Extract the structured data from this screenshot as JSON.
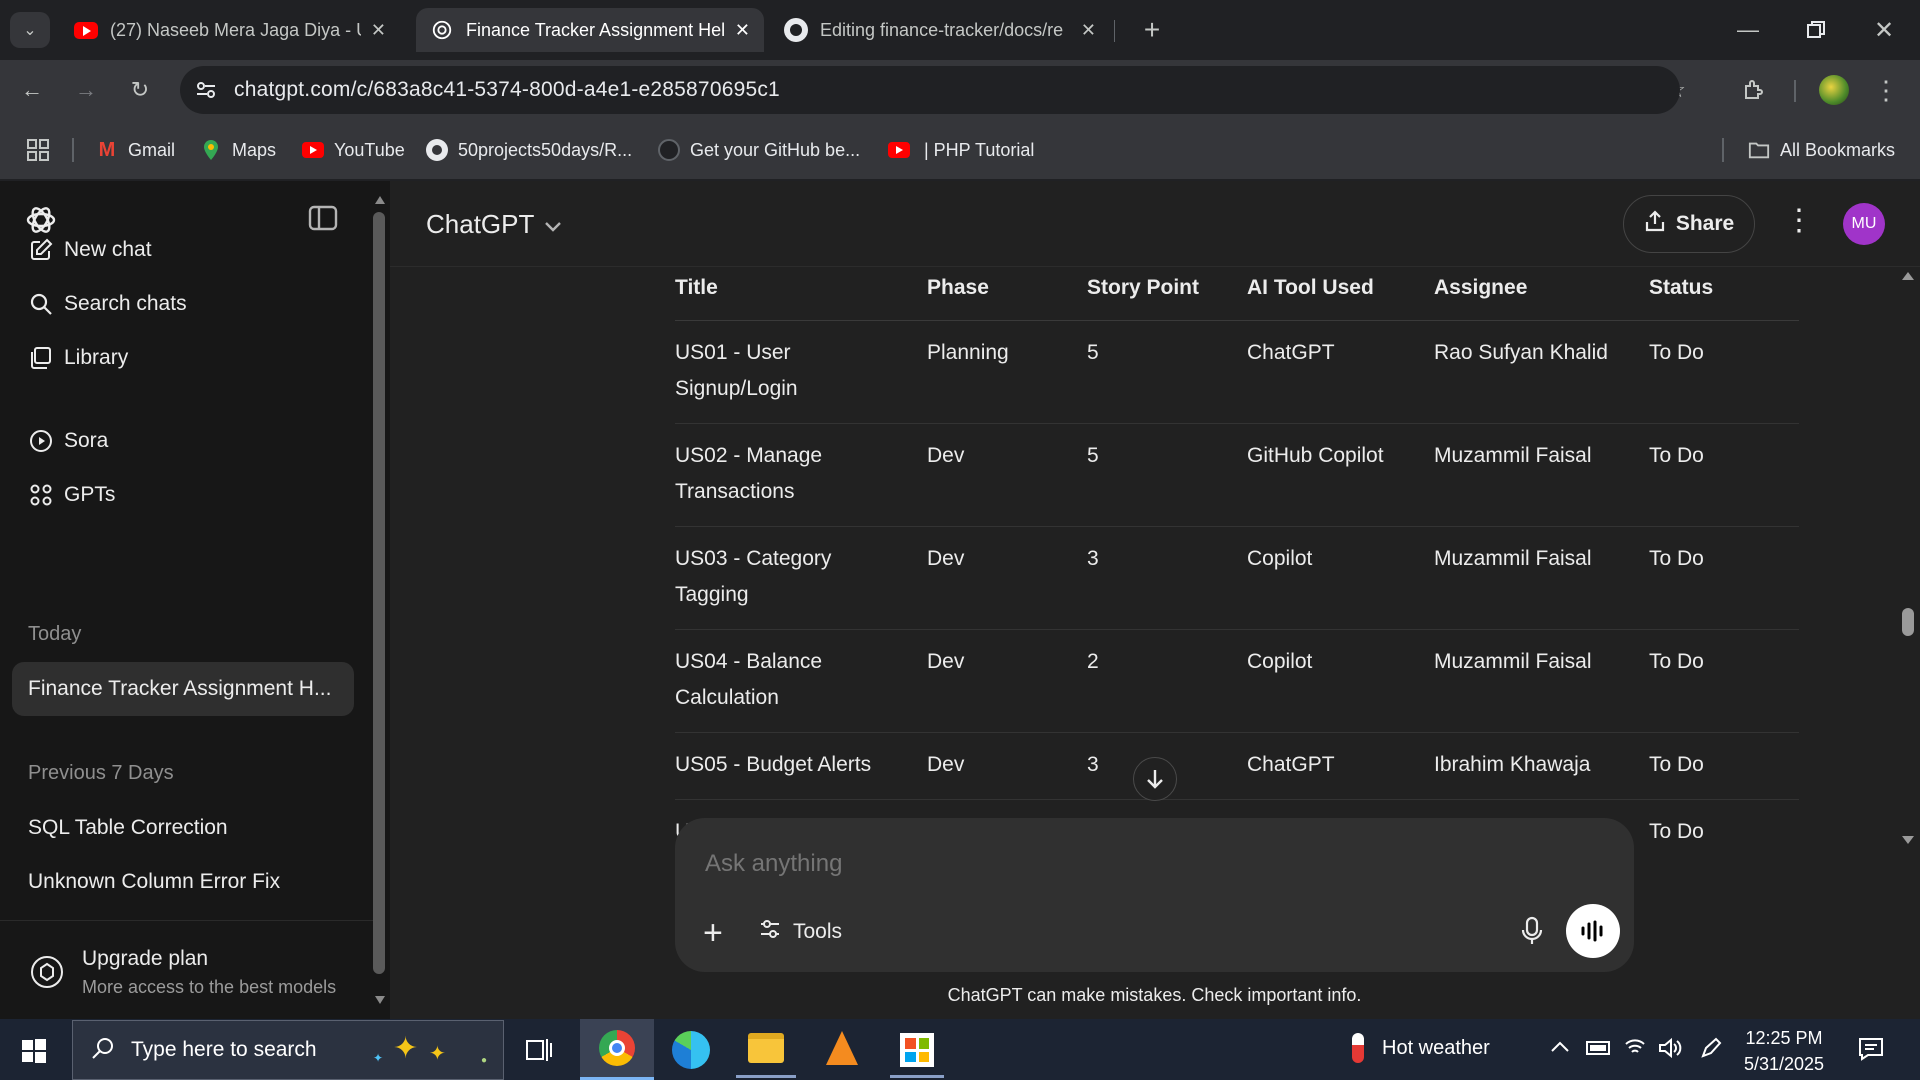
{
  "browser": {
    "tabs": [
      {
        "title": "(27) Naseeb Mera Jaga Diya - U",
        "icon": "youtube-icon"
      },
      {
        "title": "Finance Tracker Assignment Hel",
        "icon": "chatgpt-icon",
        "active": true
      },
      {
        "title": "Editing finance-tracker/docs/re",
        "icon": "github-icon"
      }
    ],
    "url": "chatgpt.com/c/683a8c41-5374-800d-a4e1-e285870695c1",
    "bookmarks": [
      "Gmail",
      "Maps",
      "YouTube",
      "50projects50days/R...",
      "Get your GitHub be...",
      "| PHP Tutorial"
    ],
    "all_bookmarks": "All Bookmarks"
  },
  "sidebar": {
    "nav": {
      "new_chat": "New chat",
      "search": "Search chats",
      "library": "Library",
      "sora": "Sora",
      "gpts": "GPTs"
    },
    "today_label": "Today",
    "today_chats": [
      "Finance Tracker Assignment H..."
    ],
    "prev_label": "Previous 7 Days",
    "prev_chats": [
      "SQL Table Correction",
      "Unknown Column Error Fix"
    ],
    "upgrade_title": "Upgrade plan",
    "upgrade_sub": "More access to the best models"
  },
  "header": {
    "model": "ChatGPT",
    "share": "Share",
    "avatar": "MU"
  },
  "table": {
    "headers": [
      "Title",
      "Phase",
      "Story Point",
      "AI Tool Used",
      "Assignee",
      "Status"
    ],
    "rows": [
      [
        "US01 - User Signup/Login",
        "Planning",
        "5",
        "ChatGPT",
        "Rao Sufyan Khalid",
        "To Do"
      ],
      [
        "US02 - Manage Transactions",
        "Dev",
        "5",
        "GitHub Copilot",
        "Muzammil Faisal",
        "To Do"
      ],
      [
        "US03 - Category Tagging",
        "Dev",
        "3",
        "Copilot",
        "Muzammil Faisal",
        "To Do"
      ],
      [
        "US04 - Balance Calculation",
        "Dev",
        "2",
        "Copilot",
        "Muzammil Faisal",
        "To Do"
      ],
      [
        "US05 - Budget Alerts",
        "Dev",
        "3",
        "ChatGPT",
        "Ibrahim Khawaja",
        "To Do"
      ],
      [
        "U",
        "",
        "",
        "",
        "",
        "To Do"
      ]
    ]
  },
  "composer": {
    "placeholder": "Ask anything",
    "tools": "Tools"
  },
  "disclaimer": "ChatGPT can make mistakes. Check important info.",
  "taskbar": {
    "search_placeholder": "Type here to search",
    "weather": "Hot weather",
    "time": "12:25 PM",
    "date": "5/31/2025"
  },
  "colors": {
    "avatar": "#a034c9",
    "youtube": "#ff0000",
    "taskbar": "#1c2433"
  }
}
